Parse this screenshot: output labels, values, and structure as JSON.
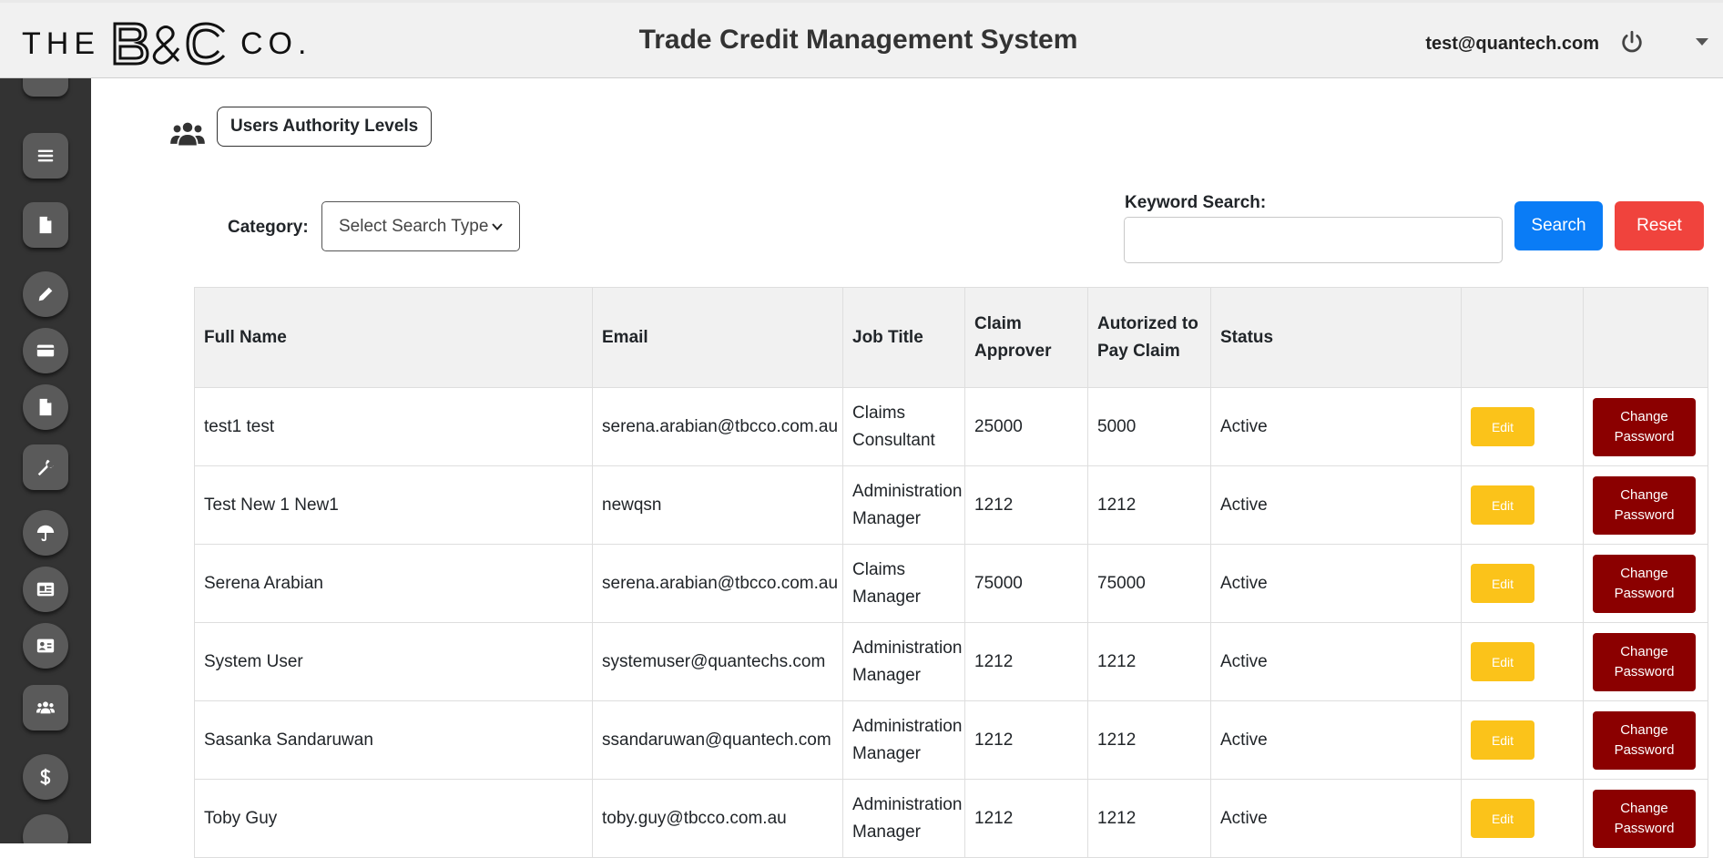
{
  "header": {
    "logo_the": "THE",
    "logo_co": "CO.",
    "app_title": "Trade Credit Management System",
    "user_email": "test@quantech.com"
  },
  "sidebar": {
    "items": [
      {
        "icon": "list-icon"
      },
      {
        "icon": "file-icon"
      },
      {
        "icon": "pencil-icon"
      },
      {
        "icon": "credit-card-icon"
      },
      {
        "icon": "document-icon"
      },
      {
        "icon": "wrench-icon"
      },
      {
        "icon": "umbrella-icon"
      },
      {
        "icon": "id-card-icon"
      },
      {
        "icon": "address-card-icon"
      },
      {
        "icon": "users-icon"
      },
      {
        "icon": "dollar-icon"
      }
    ]
  },
  "page": {
    "heading": "Users Authority Levels",
    "category_label": "Category:",
    "category_selected": "Select Search Type",
    "keyword_label": "Keyword Search:",
    "keyword_value": "",
    "search_label": "Search",
    "reset_label": "Reset"
  },
  "table": {
    "columns": [
      "Full Name",
      "Email",
      "Job Title",
      "Claim Approver",
      "Autorized to Pay Claim",
      "Status",
      "",
      ""
    ],
    "edit_label": "Edit",
    "change_password_label": "Change\nPassword",
    "rows": [
      {
        "full_name": "test1 test",
        "email": "serena.arabian@tbcco.com.au",
        "job_title": "Claims Consultant",
        "claim_approver": "25000",
        "authorized": "5000",
        "status": "Active"
      },
      {
        "full_name": "Test New 1 New1",
        "email": "newqsn",
        "job_title": "Administration Manager",
        "claim_approver": "1212",
        "authorized": "1212",
        "status": "Active"
      },
      {
        "full_name": "Serena Arabian",
        "email": "serena.arabian@tbcco.com.au",
        "job_title": "Claims Manager",
        "claim_approver": "75000",
        "authorized": "75000",
        "status": "Active"
      },
      {
        "full_name": "System User",
        "email": "systemuser@quantechs.com",
        "job_title": "Administration Manager",
        "claim_approver": "1212",
        "authorized": "1212",
        "status": "Active"
      },
      {
        "full_name": "Sasanka Sandaruwan",
        "email": "ssandaruwan@quantech.com",
        "job_title": "Administration Manager",
        "claim_approver": "1212",
        "authorized": "1212",
        "status": "Active"
      },
      {
        "full_name": "Toby Guy",
        "email": "toby.guy@tbcco.com.au",
        "job_title": "Administration Manager",
        "claim_approver": "1212",
        "authorized": "1212",
        "status": "Active"
      }
    ]
  },
  "colors": {
    "search": "#0a7cf6",
    "reset": "#f0433d",
    "edit": "#fbc31a",
    "change_password": "#8b0000",
    "sidebar": "#333333"
  }
}
